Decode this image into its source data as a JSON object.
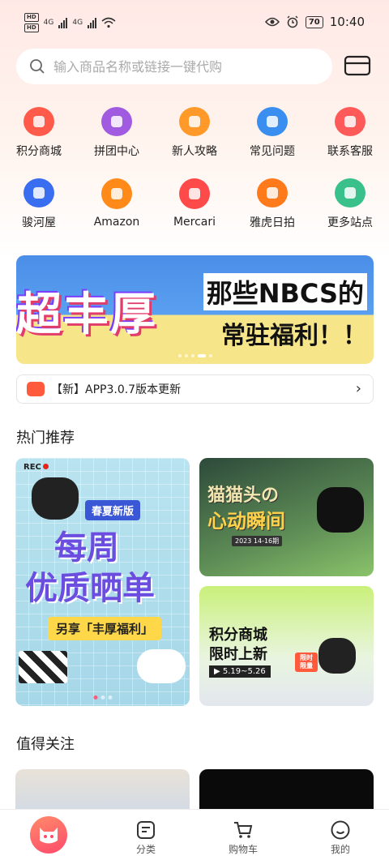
{
  "status_bar": {
    "hd1": "HD",
    "hd2": "HD",
    "net1": "4G",
    "net2": "4G",
    "battery": "70",
    "time": "10:40"
  },
  "search": {
    "placeholder": "输入商品名称或链接一键代购"
  },
  "grid": [
    {
      "label": "积分商城",
      "icon": "gift-box-icon",
      "color": "#ff5a4a"
    },
    {
      "label": "拼团中心",
      "icon": "flower-icon",
      "color": "#a05be0"
    },
    {
      "label": "新人攻略",
      "icon": "treasure-chest-icon",
      "color": "#ff9a2a"
    },
    {
      "label": "常见问题",
      "icon": "question-book-icon",
      "color": "#3a8ef0"
    },
    {
      "label": "联系客服",
      "icon": "cat-service-icon",
      "color": "#ff5a5a"
    },
    {
      "label": "骏河屋",
      "icon": "surugaya-icon",
      "color": "#3a6ef0"
    },
    {
      "label": "Amazon",
      "icon": "amazon-icon",
      "color": "#ff8a1a"
    },
    {
      "label": "Mercari",
      "icon": "mercari-icon",
      "color": "#ff4a4a"
    },
    {
      "label": "雅虎日拍",
      "icon": "yahoo-auction-icon",
      "color": "#ff7a1a"
    },
    {
      "label": "更多站点",
      "icon": "clover-icon",
      "color": "#3ac08a"
    }
  ],
  "banner": {
    "big_text": "超丰厚",
    "line1": "那些NBCS的",
    "line2": "常驻福利！！"
  },
  "notice": {
    "text": "【新】APP3.0.7版本更新"
  },
  "hot_section": {
    "title": "热门推荐",
    "left_card": {
      "rec": "REC",
      "tag": "春夏新版",
      "line1": "每周",
      "line2": "优质晒单",
      "sub": "另享「丰厚福利」"
    },
    "top_right_card": {
      "line1": "猫猫头の",
      "line2": "心动瞬间",
      "date": "2023 14-16期"
    },
    "bottom_right_card": {
      "line1": "积分商城",
      "line2": "限时上新",
      "date": "▶ 5.19~5.26",
      "tag": "限时限量"
    }
  },
  "worth_section": {
    "title": "值得关注"
  },
  "tabbar": {
    "category": "分类",
    "cart": "购物车",
    "mine": "我的"
  }
}
